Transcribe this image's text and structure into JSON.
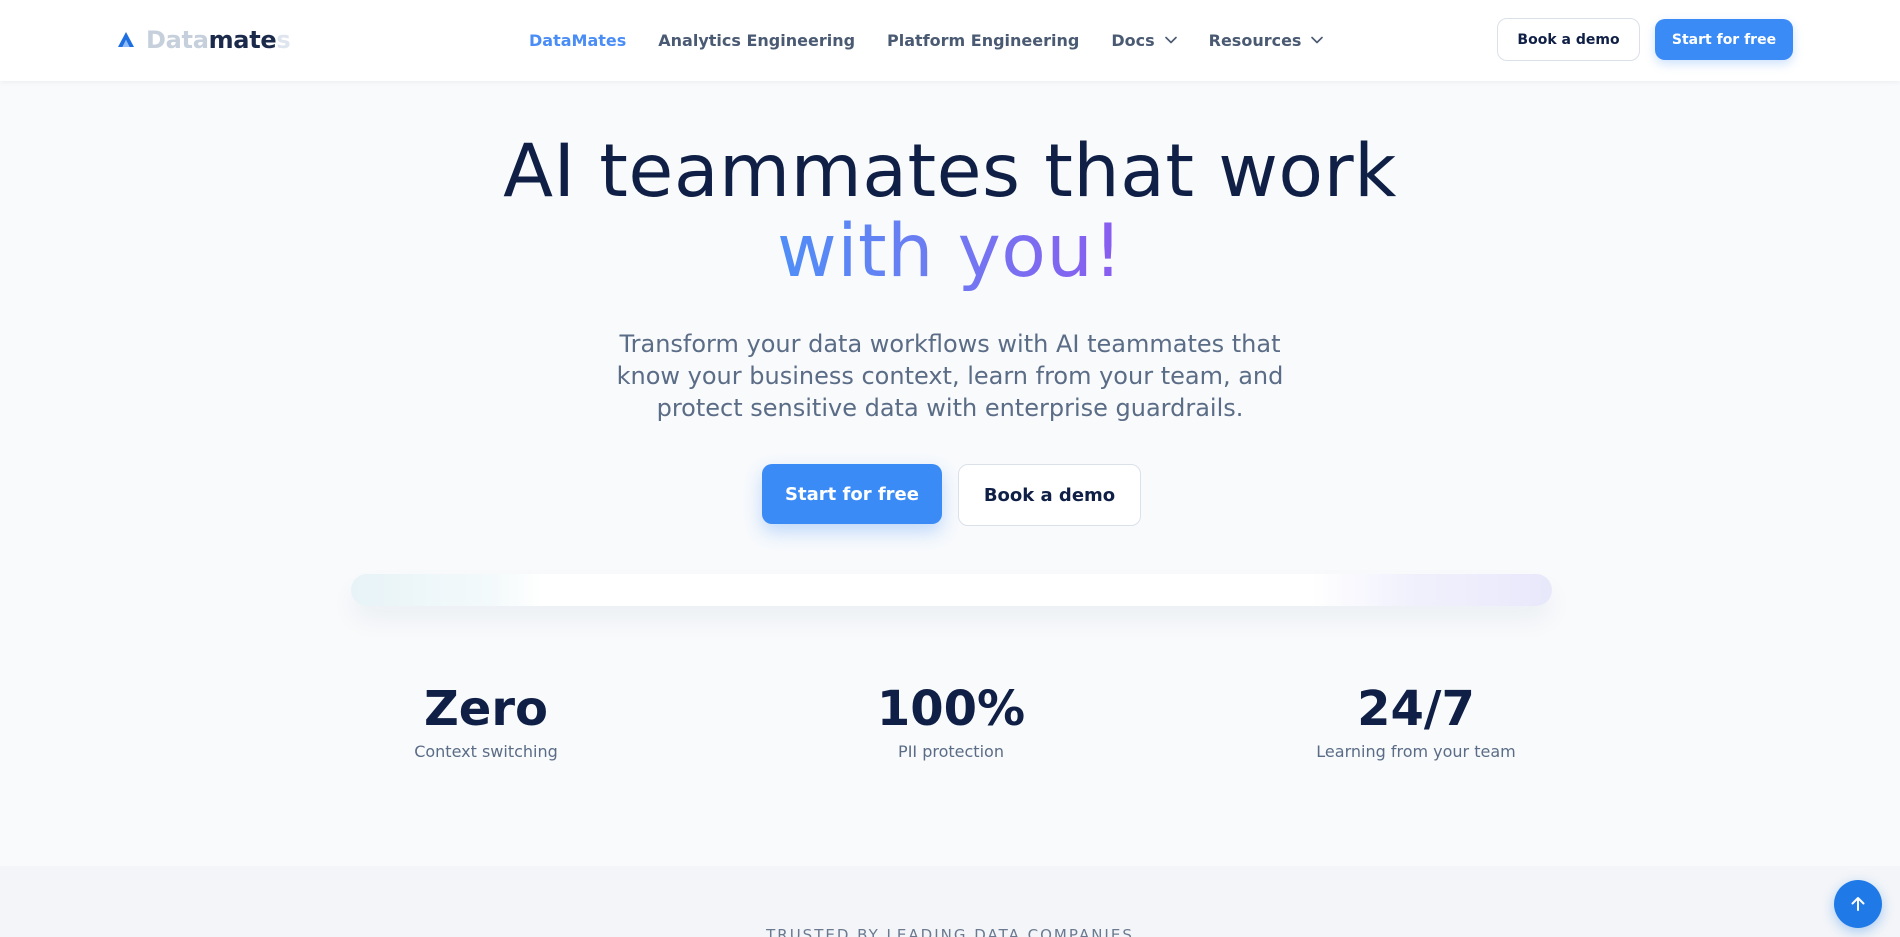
{
  "brand": {
    "logo_part_light": "Data",
    "logo_part_bold": "mate",
    "logo_part_fade": "s",
    "accent_color": "#3b8bf7",
    "icon": "datamates-logo-icon"
  },
  "nav": {
    "items": [
      {
        "label": "DataMates",
        "active": true
      },
      {
        "label": "Analytics Engineering"
      },
      {
        "label": "Platform Engineering"
      },
      {
        "label": "Docs",
        "has_dropdown": true,
        "icon": "chevron-down-icon"
      },
      {
        "label": "Resources",
        "has_dropdown": true,
        "icon": "chevron-down-icon"
      }
    ],
    "book_demo_label": "Book a demo",
    "start_free_label": "Start for free"
  },
  "hero": {
    "title_line1": "AI teammates that work",
    "title_line2": "with you!",
    "subtitle": "Transform your data workflows with AI teammates that know your business context, learn from your team, and protect sensitive data with enterprise guardrails.",
    "primary_cta": "Start for free",
    "secondary_cta": "Book a demo"
  },
  "stats": [
    {
      "value": "Zero",
      "label": "Context switching"
    },
    {
      "value": "100%",
      "label": "PII protection"
    },
    {
      "value": "24/7",
      "label": "Learning from your team"
    }
  ],
  "trusted": {
    "heading": "TRUSTED BY LEADING DATA COMPANIES"
  },
  "scroll_top": {
    "icon": "arrow-up-icon"
  }
}
